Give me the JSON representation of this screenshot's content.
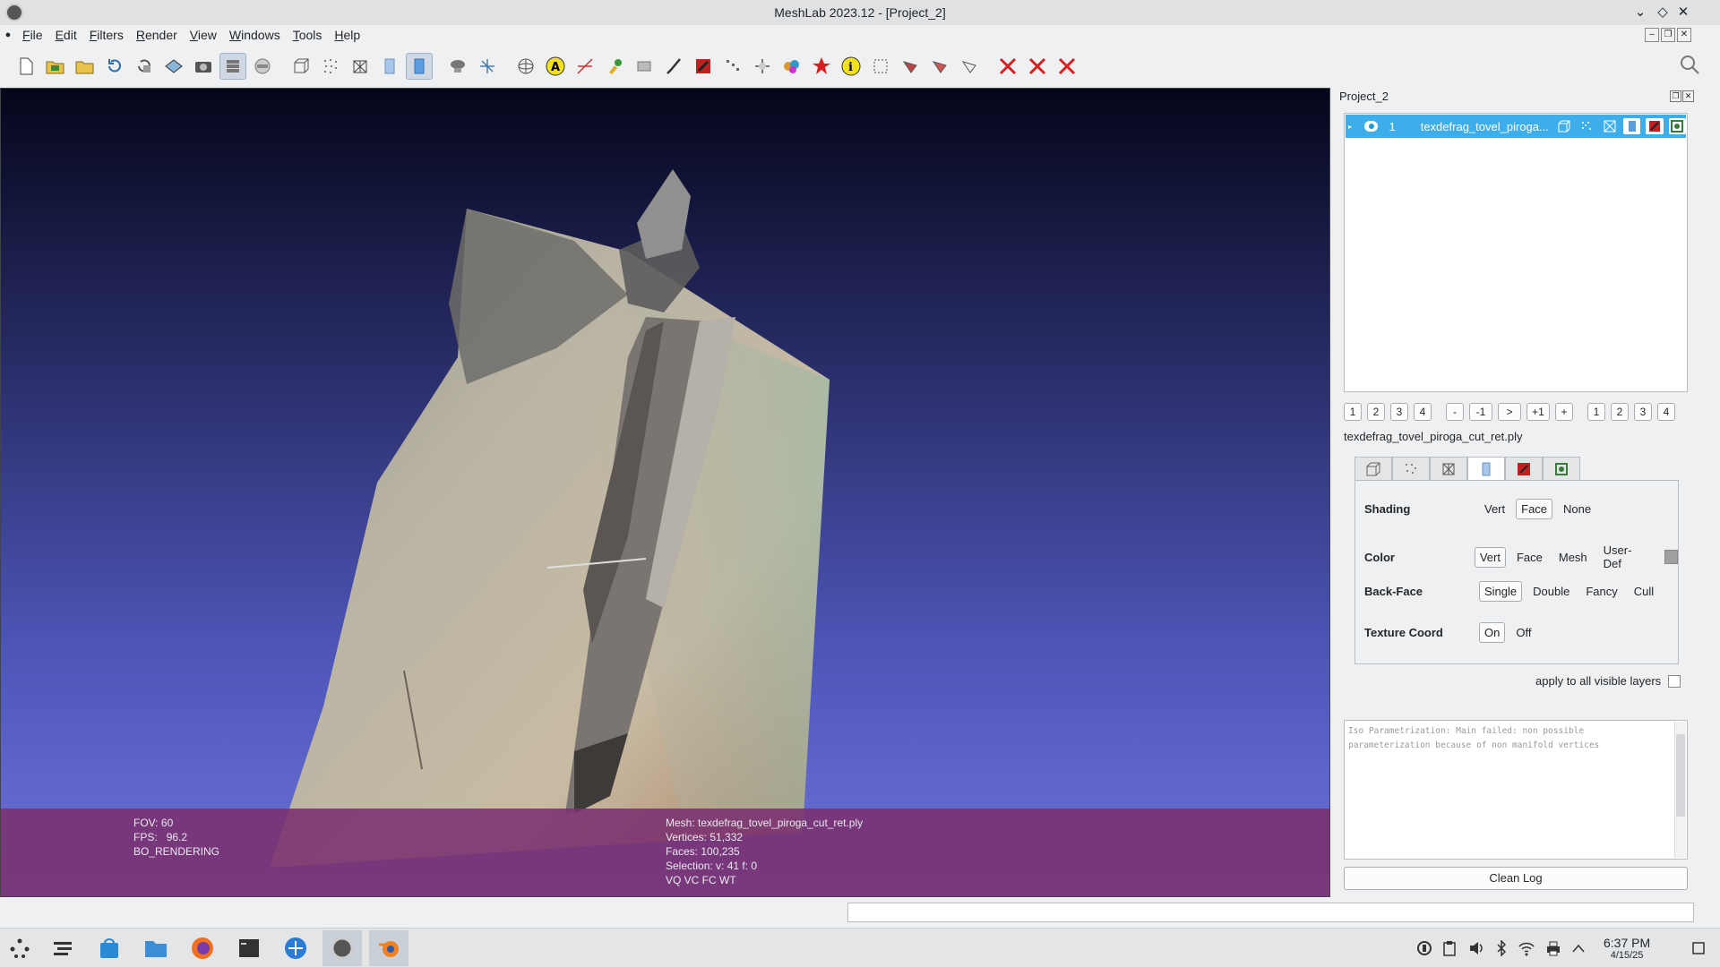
{
  "window": {
    "title": "MeshLab 2023.12 - [Project_2]"
  },
  "menu": [
    "File",
    "Edit",
    "Filters",
    "Render",
    "View",
    "Windows",
    "Tools",
    "Help"
  ],
  "toolbar": {
    "icons": [
      "new-project-icon",
      "open-project-icon",
      "import-mesh-icon",
      "reload-icon",
      "reload-all-icon",
      "export-mesh-icon",
      "snapshot-icon",
      "layers-icon",
      "raster-icon",
      "bbox-icon",
      "points-icon",
      "wireframe-icon",
      "flat-lines-icon",
      "flat-icon",
      "light-icon",
      "axes-icon",
      "trackball-icon",
      "annotation-icon",
      "measure-icon",
      "paint-icon",
      "select-icon",
      "brush-icon",
      "texture-icon",
      "align-icon",
      "manipulator-icon",
      "color-paint-icon",
      "georef-icon",
      "info-icon",
      "select-faces-icon",
      "delete-vertices-icon",
      "delete-faces-icon",
      "select-connected-icon",
      "remove-selected-icon",
      "remove-selected-faces-icon",
      "remove-all-icon"
    ]
  },
  "viewport_info": {
    "fov": "FOV: 60",
    "fps_label": "FPS:",
    "fps_value": "96.2",
    "rendering": "BO_RENDERING",
    "mesh": "Mesh: texdefrag_tovel_piroga_cut_ret.ply",
    "vertices": "Vertices: 51,332",
    "faces": "Faces: 100,235",
    "selection": "Selection: v: 41 f: 0",
    "flags": "VQ VC FC WT"
  },
  "dock": {
    "title": "Project_2",
    "layer": {
      "number": "1",
      "name": "texdefrag_tovel_piroga..."
    },
    "layer_buttons": [
      "1",
      "2",
      "3",
      "4",
      "-",
      "-1",
      ">",
      "+1",
      "+",
      "1",
      "2",
      "3",
      "4"
    ],
    "mesh_file": "texdefrag_tovel_piroga_cut_ret.ply",
    "shading": {
      "label": "Shading",
      "options": [
        "Vert",
        "Face",
        "None"
      ],
      "selected": "Face"
    },
    "color": {
      "label": "Color",
      "options": [
        "Vert",
        "Face",
        "Mesh",
        "User-Def"
      ],
      "selected": "Vert"
    },
    "backface": {
      "label": "Back-Face",
      "options": [
        "Single",
        "Double",
        "Fancy",
        "Cull"
      ],
      "selected": "Single"
    },
    "texcoord": {
      "label": "Texture Coord",
      "options": [
        "On",
        "Off"
      ],
      "selected": "On"
    },
    "apply_all": "apply to all visible layers",
    "log": "Iso Parametrization: Main failed: non possible parameterization because of non manifold vertices",
    "clean_log": "Clean Log"
  },
  "taskbar": {
    "time": "6:37 PM",
    "date": "4/15/25",
    "apps": [
      "application-launcher-icon",
      "pager-icon",
      "discover-icon",
      "file-manager-icon",
      "firefox-icon",
      "terminal-icon",
      "app-icon",
      "meshlab-icon",
      "blender-icon"
    ]
  },
  "colors": {
    "accent": "#3daee9",
    "overlay": "#7a306e",
    "viewport_top": "#05061a",
    "viewport_bottom": "#6e72d8"
  }
}
